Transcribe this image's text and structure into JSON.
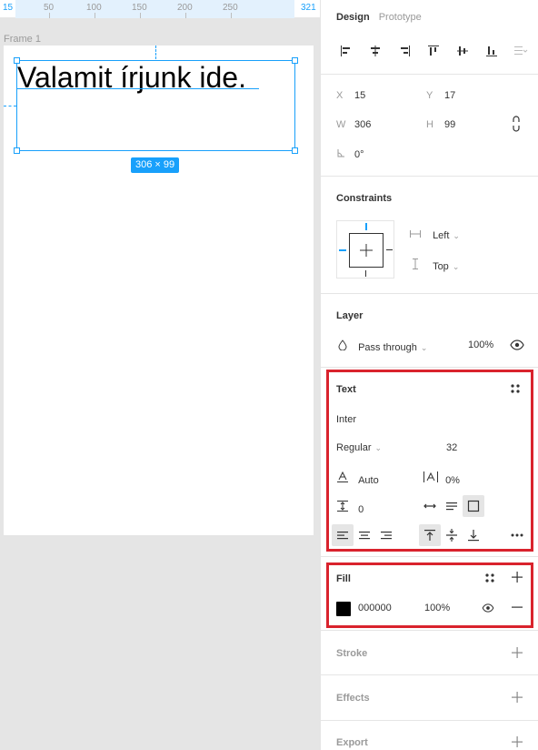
{
  "ruler": {
    "left_value": "15",
    "labels": [
      "50",
      "100",
      "150",
      "200",
      "250"
    ],
    "right_value": "321"
  },
  "canvas": {
    "frame_label": "Frame 1",
    "text_content": "Valamit írjunk ide.",
    "dimension_badge": "306 × 99"
  },
  "panel": {
    "tabs": {
      "design": "Design",
      "prototype": "Prototype"
    },
    "position": {
      "x_label": "X",
      "x": "15",
      "y_label": "Y",
      "y": "17",
      "w_label": "W",
      "w": "306",
      "h_label": "H",
      "h": "99",
      "rotation": "0°"
    },
    "constraints": {
      "title": "Constraints",
      "horizontal": "Left",
      "vertical": "Top"
    },
    "layer": {
      "title": "Layer",
      "blend_mode": "Pass through",
      "opacity": "100%"
    },
    "text": {
      "title": "Text",
      "font_family": "Inter",
      "font_style": "Regular",
      "font_size": "32",
      "line_height": "Auto",
      "letter_spacing": "0%",
      "paragraph_spacing": "0"
    },
    "fill": {
      "title": "Fill",
      "color_hex": "000000",
      "opacity": "100%"
    },
    "stroke": {
      "title": "Stroke"
    },
    "effects": {
      "title": "Effects"
    },
    "export": {
      "title": "Export"
    }
  },
  "colors": {
    "selection_blue": "#18a0fb",
    "highlight_red": "#d9232d",
    "fill_color": "#000000"
  }
}
